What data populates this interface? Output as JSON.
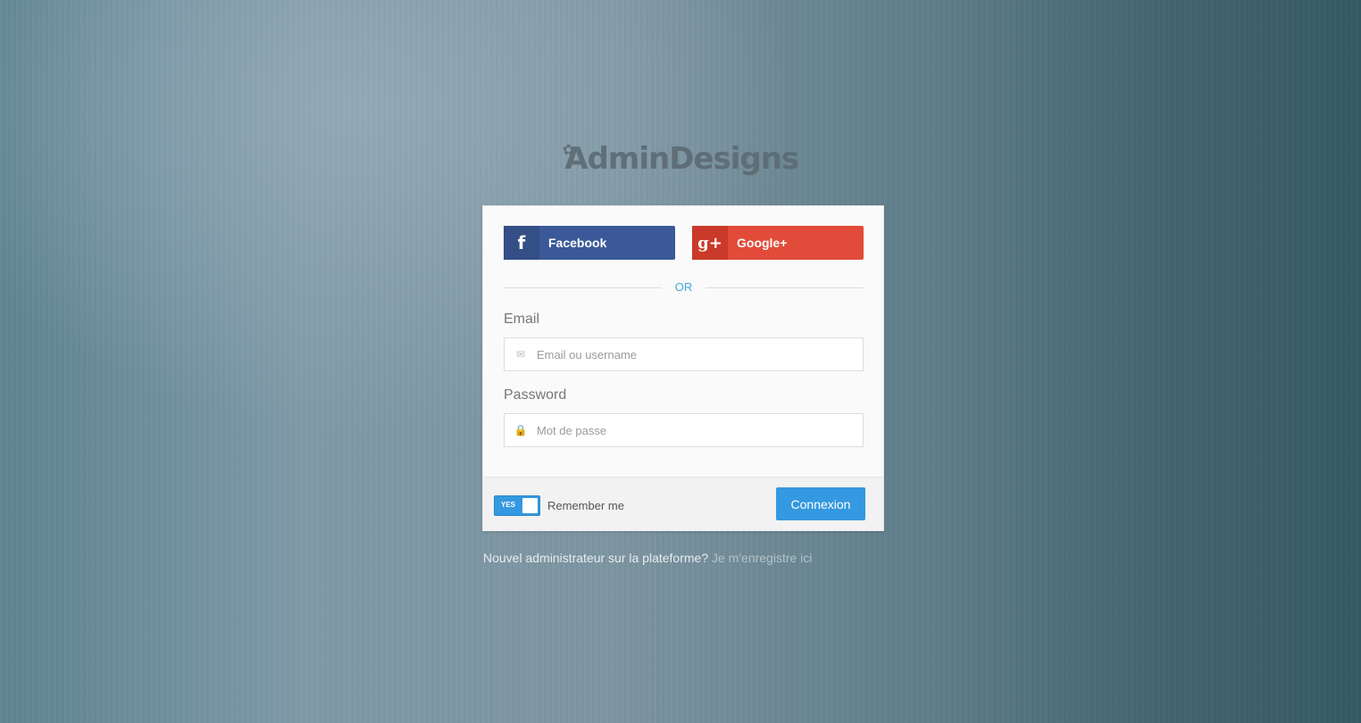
{
  "logo": {
    "text": "AdminDesigns"
  },
  "social": {
    "facebook_label": "Facebook",
    "facebook_icon": "f",
    "google_label": "Google+",
    "google_icon": "g+"
  },
  "divider": {
    "text": "OR"
  },
  "email": {
    "label": "Email",
    "placeholder": "Email ou username",
    "value": ""
  },
  "password": {
    "label": "Password",
    "placeholder": "Mot de passe",
    "value": ""
  },
  "remember": {
    "toggle_label": "YES",
    "label": "Remember me"
  },
  "submit": {
    "label": "Connexion"
  },
  "register": {
    "text": "Nouvel administrateur sur la plateforme?",
    "link": "Je m'enregistre ici"
  },
  "colors": {
    "facebook": "#3b5998",
    "google": "#e24b39",
    "primary": "#3499e0",
    "divider_text": "#3fa6d8"
  }
}
